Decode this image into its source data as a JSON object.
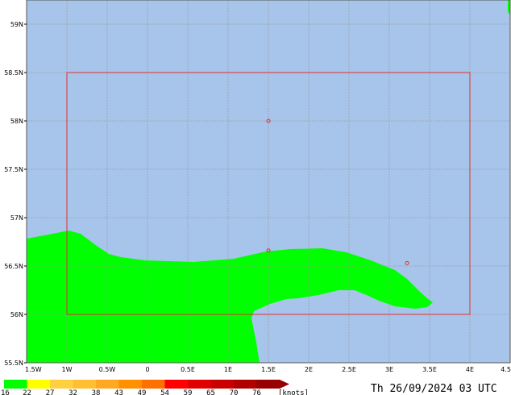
{
  "map": {
    "sea_color": "#a7c4ea",
    "wind_color": "#00ff00",
    "grid_color": "#9a9a9a",
    "box_color": "#e03030",
    "lat_labels": [
      "59N",
      "58.5N",
      "58N",
      "57.5N",
      "57N",
      "56.5N",
      "56N",
      "55.5N"
    ],
    "lon_labels": [
      "1.5W",
      "1W",
      "0.5W",
      "0",
      "0.5E",
      "1E",
      "1.5E",
      "2E",
      "2.5E",
      "3E",
      "3.5E",
      "4E",
      "4.5"
    ],
    "lat_range": [
      55.5,
      59.25
    ],
    "lon_range": [
      -1.5,
      4.5
    ],
    "area_box": {
      "lon": [
        -1,
        4
      ],
      "lat": [
        56,
        58.5
      ]
    },
    "markers": [
      {
        "lon": 1.5,
        "lat": 58.0
      },
      {
        "lon": 1.5,
        "lat": 56.66
      },
      {
        "lon": 3.22,
        "lat": 56.53
      }
    ]
  },
  "legend": {
    "values": [
      "16",
      "22",
      "27",
      "32",
      "38",
      "43",
      "49",
      "54",
      "59",
      "65",
      "70",
      "76"
    ],
    "unit": "[knots]",
    "colors": [
      "#00ff00",
      "#ffff00",
      "#ffd040",
      "#ffbf30",
      "#ffa820",
      "#ff9000",
      "#ff7000",
      "#ff0000",
      "#e00000",
      "#c80000",
      "#b00000",
      "#980000"
    ]
  },
  "timestamp": "Th 26/09/2024 03 UTC"
}
